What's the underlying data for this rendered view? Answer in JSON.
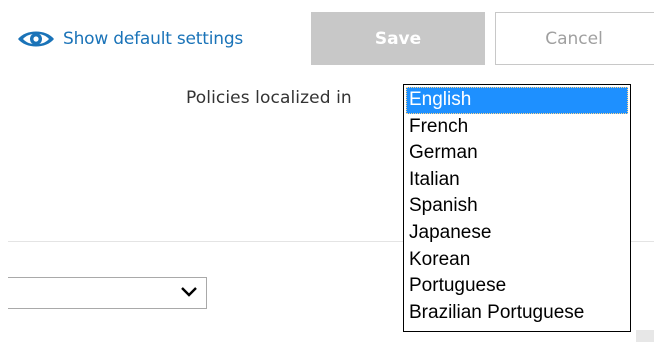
{
  "toolbar": {
    "show_defaults_label": "Show default settings",
    "save_label": "Save",
    "cancel_label": "Cancel",
    "link_color": "#1a73b8",
    "save_bg_color": "#c8c8c8"
  },
  "localization": {
    "label": "Policies localized in",
    "selected": "English",
    "options": [
      "English",
      "French",
      "German",
      "Italian",
      "Spanish",
      "Japanese",
      "Korean",
      "Portuguese",
      "Brazilian Portuguese"
    ],
    "selected_color": "#1e90ff"
  },
  "icons": {
    "show_defaults": "eye-icon",
    "inner_select": "chevron-down-icon"
  }
}
